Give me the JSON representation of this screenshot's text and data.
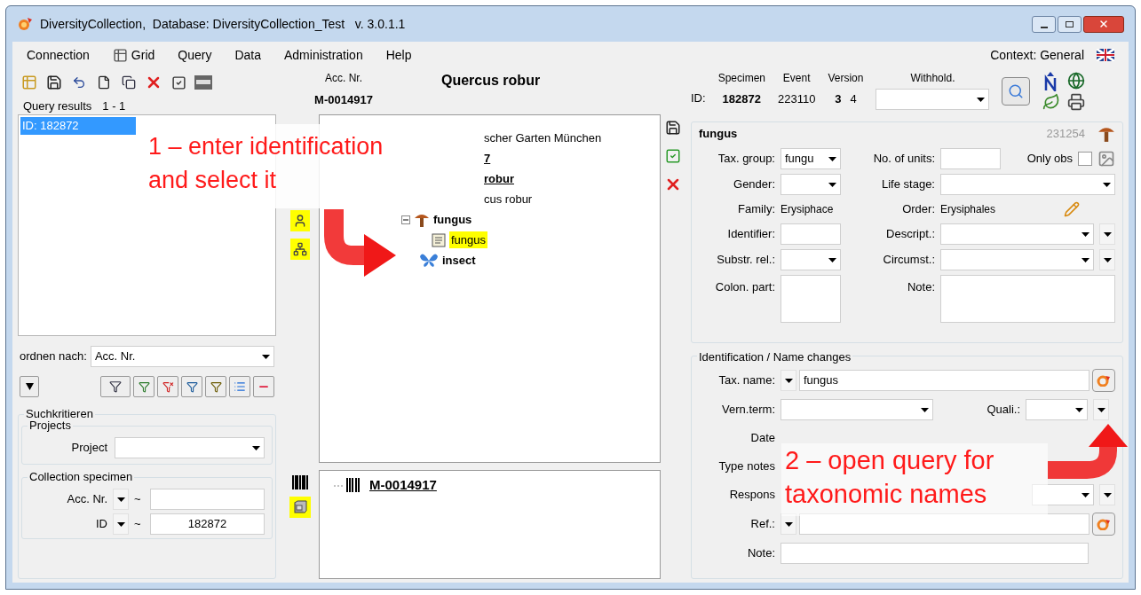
{
  "window": {
    "title": "DiversityCollection,  Database: DiversityCollection_Test   v. 3.0.1.1"
  },
  "menu": [
    {
      "label": "Connection",
      "kind": "text"
    },
    {
      "label": "Grid",
      "kind": "grid"
    },
    {
      "label": "Query",
      "kind": "text"
    },
    {
      "label": "Data",
      "kind": "text"
    },
    {
      "label": "Administration",
      "kind": "text"
    },
    {
      "label": "Help",
      "kind": "text"
    }
  ],
  "context": "Context: General",
  "query_results": {
    "label": "Query results",
    "count": "1 - 1",
    "items": [
      {
        "label": "ID: 182872",
        "selected": true
      }
    ]
  },
  "order_by": {
    "label": "ordnen nach:",
    "value": "Acc. Nr."
  },
  "search": {
    "title": "Suchkritieren",
    "projects": {
      "title": "Projects",
      "fields": [
        {
          "label": "Project"
        }
      ]
    },
    "collection_specimen": {
      "title": "Collection specimen",
      "fields": [
        {
          "label": "Acc. Nr.",
          "operator": "~"
        },
        {
          "label": "ID",
          "operator": "~",
          "value": "182872"
        }
      ]
    }
  },
  "specimen_header": {
    "acc_label": "Acc. Nr.",
    "acc_value": "M-0014917",
    "taxon": "Quercus robur"
  },
  "tree": [
    {
      "label": "scher Garten München",
      "kind": "partial",
      "bold": false,
      "underline": false
    },
    {
      "label": "7",
      "kind": "partial",
      "bold": true,
      "underline": true
    },
    {
      "label": "robur",
      "kind": "partial",
      "bold": true,
      "underline": true
    },
    {
      "label": "cus robur",
      "kind": "partial",
      "bold": false,
      "underline": false
    },
    {
      "label": "fungus",
      "kind": "fungus_unit",
      "expanded": true,
      "children": [
        {
          "label": "fungus",
          "kind": "identification",
          "selected": true
        }
      ]
    },
    {
      "label": "insect",
      "kind": "insect_unit"
    }
  ],
  "part_tree": [
    {
      "label": "M-0014917"
    }
  ],
  "ids": {
    "id_label": "ID:",
    "columns": [
      {
        "label": "Specimen",
        "values": [
          {
            "text": "182872",
            "current": true
          }
        ]
      },
      {
        "label": "Event",
        "values": [
          {
            "text": "223110",
            "current": false
          }
        ]
      },
      {
        "label": "Version",
        "values": [
          {
            "text": "3",
            "current": true
          },
          {
            "text": "4",
            "current": false
          }
        ]
      }
    ],
    "withhold_label": "Withhold."
  },
  "unit": {
    "title": "fungus",
    "id": "231254",
    "tax_group": {
      "label": "Tax. group:",
      "value": "fungu"
    },
    "units": {
      "label": "No. of units:"
    },
    "only_obs": {
      "label": "Only obs",
      "checked": false
    },
    "gender": {
      "label": "Gender:"
    },
    "life_stage": {
      "label": "Life stage:"
    },
    "family": {
      "label": "Family:",
      "value": "Erysiphace"
    },
    "order": {
      "label": "Order:",
      "value": "Erysiphales"
    },
    "identifier": {
      "label": "Identifier:"
    },
    "descript": {
      "label": "Descript.:"
    },
    "substr": {
      "label": "Substr. rel.:"
    },
    "circumst": {
      "label": "Circumst.:"
    },
    "colon": {
      "label": "Colon. part:"
    },
    "note": {
      "label": "Note:"
    }
  },
  "identification": {
    "title": "Identification / Name changes",
    "tax_name": {
      "label": "Tax. name:",
      "value": "fungus"
    },
    "vern": {
      "label": "Vern.term:"
    },
    "quali": {
      "label": "Quali.:"
    },
    "date": {
      "label": "Date"
    },
    "type_notes": {
      "label": "Type notes"
    },
    "respons": {
      "label": "Respons"
    },
    "ref": {
      "label": "Ref.:"
    },
    "note": {
      "label": "Note:"
    }
  },
  "callouts": [
    {
      "lines": [
        "1 – enter identification",
        "and select it"
      ]
    },
    {
      "lines": [
        "2 – open query for",
        "taxonomic names"
      ]
    }
  ]
}
